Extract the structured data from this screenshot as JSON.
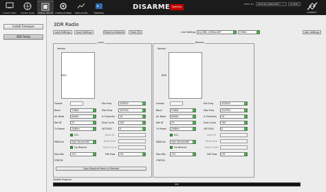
{
  "header": {
    "nav": [
      {
        "label": "FLIGHT DATA",
        "icon": "monitor-icon"
      },
      {
        "label": "FLIGHT PLAN",
        "icon": "globe-icon"
      },
      {
        "label": "INITIAL SETUP",
        "icon": "setup-icon"
      },
      {
        "label": "CONFIG/TUNING",
        "icon": "config-icon"
      },
      {
        "label": "SIMULATION",
        "icon": "simulation-icon"
      },
      {
        "label": "TERMINAL",
        "icon": "terminal-icon"
      },
      {
        "label": "HELP",
        "icon": "help-icon"
      },
      {
        "label": "DONATE",
        "icon": "donate-icon"
      }
    ],
    "status": "DISARMED",
    "mode_badge": "Stabilize",
    "port_label": "M3V2-3D",
    "baud_label": "57600",
    "port_field": "SIL2LAB_USBtoUART",
    "baud_field": "115200",
    "connect_label": "CONNECT"
  },
  "left_panel": {
    "install_firmware": "Install Firmware",
    "radio_3dr": "3DR Radio"
  },
  "main": {
    "title": "3DR Radio",
    "buttons": {
      "load": "Load Settings",
      "save": "Save Settings",
      "reset": "Reset to Defaults",
      "flash": "Flash FW",
      "adv": "Adv. Settings",
      "copy": "Copy Required Items to Remote"
    },
    "link_settings_label": "Link Settings",
    "link_port": "ttyUSB0_USBtoUART",
    "link_baud": "57600",
    "local_title": "Local",
    "remote_title": "Remote",
    "version_label": "Version",
    "rssi_label": "RSSI",
    "local": {
      "format": "",
      "baud": "57600",
      "air_baud": "64000",
      "net_id": "25",
      "tx_power": "20dBm",
      "ecc": "ECC",
      "mavlink": "High Bandwidth",
      "op_resend": "Op Resend",
      "max_win": "131",
      "min_freq": "433050",
      "max_freq": "434790",
      "channels": "10",
      "duty_cycle": "100",
      "lbt_rssi": "0",
      "node_id": "",
      "node_dest": "",
      "node_count": "",
      "rts_cts": "Off",
      "status": "STATUS:"
    },
    "remote": {
      "format": "",
      "baud": "57600",
      "air_baud": "64000",
      "net_id": "25",
      "tx_power": "20dBm",
      "ecc": "ECC",
      "mavlink": "High Bandwidth",
      "op_resend": "Op Resend",
      "max_win": "131",
      "min_freq": "433050",
      "max_freq": "434790",
      "channels": "10",
      "duty_cycle": "100",
      "lbt_rssi": "0",
      "node_id": "",
      "node_dest": "",
      "node_count": "",
      "rts_cts": "Off",
      "status": "STATUS:"
    },
    "field_labels": {
      "format": "Format",
      "baud": "Baud",
      "air_baud": "Air Baud",
      "net_id": "Net ID",
      "tx_power": "Tx Power",
      "mavlink": "MAVLink",
      "max_win": "Max Win",
      "min_freq": "Min Freq",
      "max_freq": "Max Freq",
      "channels": "# Channels",
      "duty_cycle": "Duty Cycle",
      "lbt_rssi": "LBT RSSI",
      "node_id": "Node ID",
      "node_dest": "Node Dest",
      "node_count": "Node Count",
      "rts_cts": "RTS/CTS",
      "alt_rts": "HW Flow"
    },
    "progress_label": "Update Progress",
    "progress_text": "0%",
    "progress_value": 0
  }
}
